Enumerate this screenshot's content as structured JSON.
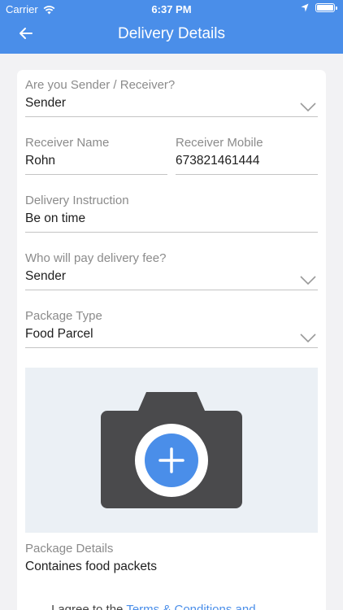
{
  "status_bar": {
    "carrier": "Carrier",
    "time": "6:37 PM"
  },
  "header": {
    "title": "Delivery Details",
    "back_icon": "back-arrow-icon"
  },
  "form": {
    "sender_receiver": {
      "label": "Are you Sender / Receiver?",
      "value": "Sender"
    },
    "receiver_name": {
      "label": "Receiver Name",
      "value": "Rohn"
    },
    "receiver_mobile": {
      "label": "Receiver Mobile",
      "value": "673821461444"
    },
    "delivery_instruction": {
      "label": "Delivery Instruction",
      "value": "Be on time"
    },
    "fee_payer": {
      "label": "Who will pay delivery fee?",
      "value": "Sender"
    },
    "package_type": {
      "label": "Package Type",
      "value": "Food Parcel"
    },
    "package_details": {
      "label": "Package Details",
      "value": "Containes food packets"
    }
  },
  "photo_upload": {
    "icon": "camera-add-icon"
  },
  "terms": {
    "prefix": "I agree to the",
    "link": "Terms & Conditions and"
  },
  "colors": {
    "primary": "#4a8ee9",
    "background": "#f2f2f4",
    "camera": "#4a4a4c",
    "photo_bg": "#ebf0f5"
  }
}
